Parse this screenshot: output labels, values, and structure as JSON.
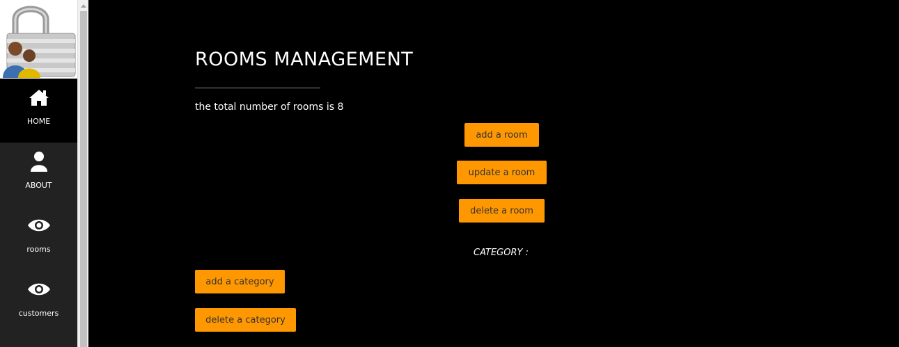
{
  "sidebar": {
    "items": [
      {
        "label": "HOME",
        "icon": "home-icon"
      },
      {
        "label": "ABOUT",
        "icon": "user-icon"
      },
      {
        "label": "rooms",
        "icon": "eye-icon"
      },
      {
        "label": "customers",
        "icon": "eye-icon"
      }
    ]
  },
  "main": {
    "title": "ROOMS MANAGEMENT",
    "total_text": "the total number of rooms is 8",
    "room_buttons": {
      "add": "add a room",
      "update": "update a room",
      "delete": "delete a room"
    },
    "category_label": "CATEGORY :",
    "category_buttons": {
      "add": "add a category",
      "delete": "delete a category"
    }
  },
  "colors": {
    "accent": "#ff9800",
    "background": "#000000",
    "sidebar": "#222222"
  }
}
